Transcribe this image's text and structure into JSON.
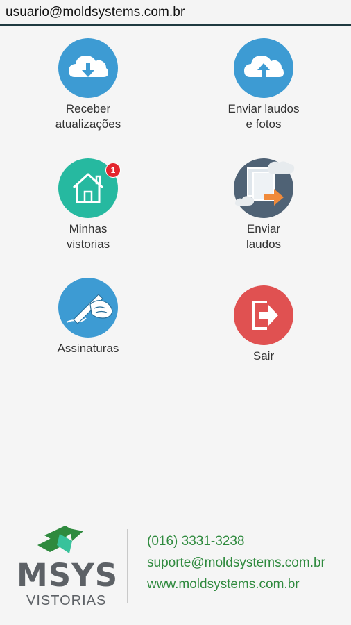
{
  "header": {
    "account_email": "usuario@moldsystems.com.br"
  },
  "menu": {
    "receive_updates": {
      "label": "Receber\natualizações",
      "icon": "cloud-download-icon",
      "color": "#3d9bd3"
    },
    "send_reports_photos": {
      "label": "Enviar laudos\ne fotos",
      "icon": "cloud-upload-icon",
      "color": "#3d9bd3"
    },
    "my_inspections": {
      "label": "Minhas\nvistorias",
      "icon": "house-icon",
      "color": "#26b9a0",
      "badge": "1"
    },
    "send_reports": {
      "label": "Enviar\nlaudos",
      "icon": "send-reports-icon",
      "color": "#4f6275"
    },
    "signatures": {
      "label": "Assinaturas",
      "icon": "signature-pen-icon",
      "color": "#3d9bd3"
    },
    "logout": {
      "label": "Sair",
      "icon": "exit-icon",
      "color": "#e05151"
    }
  },
  "footer": {
    "brand": "MSYS",
    "brand_sub": "VISTORIAS",
    "phone": "(016) 3331-3238",
    "email": "suporte@moldsystems.com.br",
    "website": "www.moldsystems.com.br",
    "brand_color": "#2f8a3e"
  }
}
